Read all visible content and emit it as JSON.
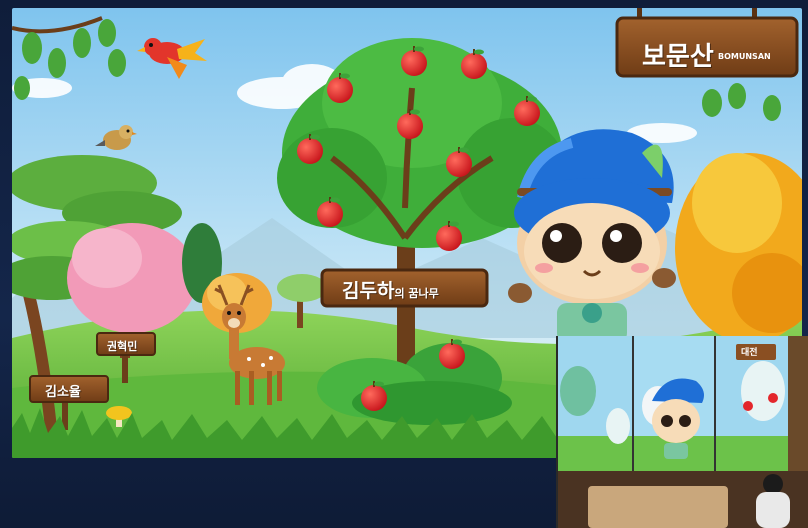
{
  "signs": {
    "mountain_title": "보문산",
    "mountain_title_en": "BOMUNSAN",
    "tree_name_main": "김두하",
    "tree_name_suffix": "의 꿈나무",
    "small_sign_1": "권혁민",
    "small_sign_2": "김소율"
  },
  "inset": {
    "screen_sign": "대전"
  },
  "colors": {
    "sky": "#9fd3f0",
    "grass": "#6cc24a",
    "wood": "#8a4f22",
    "apple": "#e3262b",
    "tree_green": "#3fae3a"
  },
  "icons": [
    "bird-icon",
    "sparrow-icon",
    "deer-icon",
    "mushroom-icon",
    "mascot-icon",
    "apple-icon"
  ]
}
